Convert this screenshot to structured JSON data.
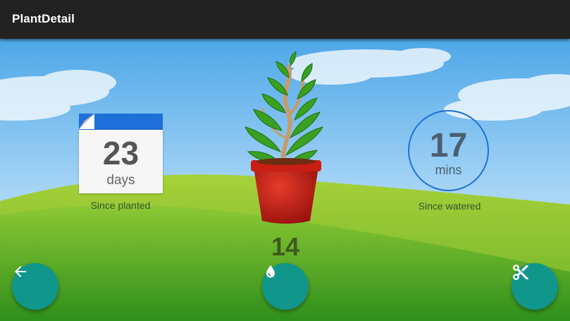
{
  "app": {
    "title": "PlantDetail"
  },
  "planted": {
    "value": "23",
    "unit": "days",
    "caption": "Since planted"
  },
  "watered": {
    "value": "17",
    "unit": "mins",
    "caption": "Since watered"
  },
  "plant": {
    "count": "14"
  },
  "actions": {
    "back_icon": "arrow-left-icon",
    "water_icon": "water-drop-icon",
    "prune_icon": "scissors-icon"
  },
  "colors": {
    "appbar": "#222222",
    "accent": "#11968c",
    "calendar_header": "#1e6fd9",
    "sky": "#6fb6ec",
    "grass": "#5aa820"
  }
}
